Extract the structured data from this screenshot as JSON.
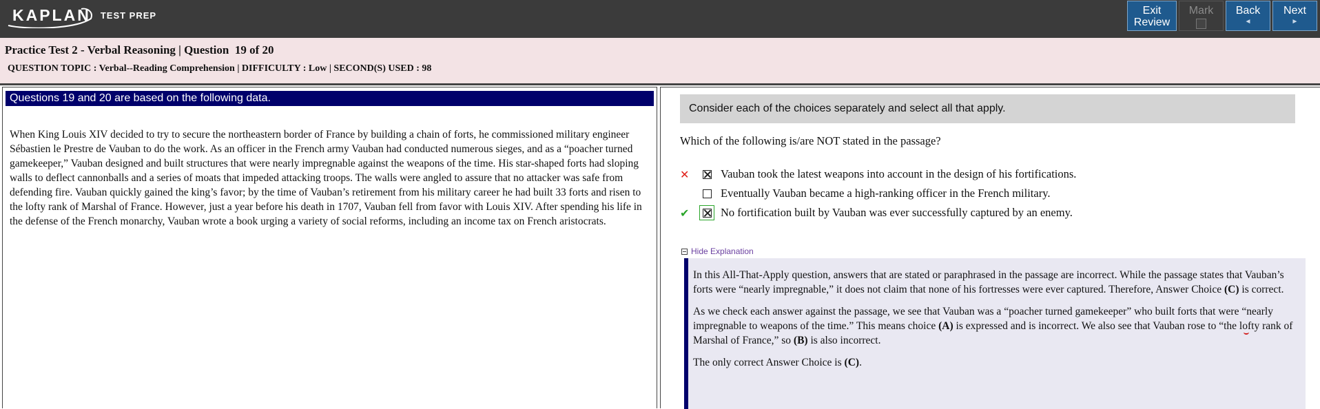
{
  "brand": {
    "logo": "KAPLAN",
    "sub": "TEST PREP"
  },
  "nav": {
    "exit_line1": "Exit",
    "exit_line2": "Review",
    "mark": "Mark",
    "back": "Back",
    "back_arrow": "◄",
    "next": "Next",
    "next_arrow": "►"
  },
  "header": {
    "title": "Practice Test 2 - Verbal Reasoning | Question  19 of 20",
    "meta": "QUESTION TOPIC : Verbal--Reading Comprehension | DIFFICULTY : Low | SECOND(S) USED : 98"
  },
  "passage": {
    "heading": "Questions 19 and 20 are based on the following data.",
    "text": "When King Louis XIV decided to try to secure the northeastern border of France by building a chain of forts, he commissioned military engineer Sébastien le Prestre de Vauban to do the work. As an officer in the French army Vauban had conducted numerous sieges, and as a “poacher turned gamekeeper,” Vauban designed and built structures that were nearly impregnable against the weapons of the time. His star-shaped forts had sloping walls to deflect cannonballs and a series of moats that impeded attacking troops. The walls were angled to assure that no attacker was safe from defending fire. Vauban quickly gained the king’s favor; by the time of Vauban’s retirement from his military career he had built 33 forts and risen to the lofty rank of Marshal of France. However, just a year before his death in 1707, Vauban fell from favor with Louis XIV. After spending his life in the defense of the French monarchy, Vauban wrote a book urging a variety of social reforms, including an income tax on French aristocrats."
  },
  "question": {
    "instruction": "Consider each of the choices separately and select all that apply.",
    "prompt": "Which of the following is/are NOT stated in the passage?",
    "choices": [
      {
        "text": "Vauban took the latest weapons into account in the design of his fortifications.",
        "checked": true,
        "result": "wrong"
      },
      {
        "text": "Eventually Vauban became a high-ranking officer in the French military.",
        "checked": false,
        "result": ""
      },
      {
        "text": "No fortification built by Vauban was ever successfully captured by an enemy.",
        "checked": true,
        "result": "correct"
      }
    ],
    "wrong_mark": "✕",
    "right_mark": "✔"
  },
  "explanation": {
    "toggle": "Hide Explanation",
    "p1_a": "In this All-That-Apply question, answers that are stated or paraphrased in the passage are incorrect. While the passage states that Vauban’s forts were “nearly impregnable,” it does not claim that none of his fortresses were ever captured. Therefore, Answer Choice ",
    "p1_b": "(C)",
    "p1_c": " is correct.",
    "p2_a": "As we check each answer against the passage, we see that Vauban was a “poacher turned gamekeeper” who built forts that were “",
    "p2_ul": "nearly impregnable to weapons of the time.",
    "p2_b": "” This means choice ",
    "p2_c": "(A)",
    "p2_d": " is expressed and is incorrect. We also see that Vauban rose to “the lofty rank of Marshal of France,” so ",
    "p2_e": "(B)",
    "p2_f": " is also incorrect.",
    "p3_a": "The only correct Answer Choice is ",
    "p3_b": "(C)",
    "p3_c": "."
  }
}
